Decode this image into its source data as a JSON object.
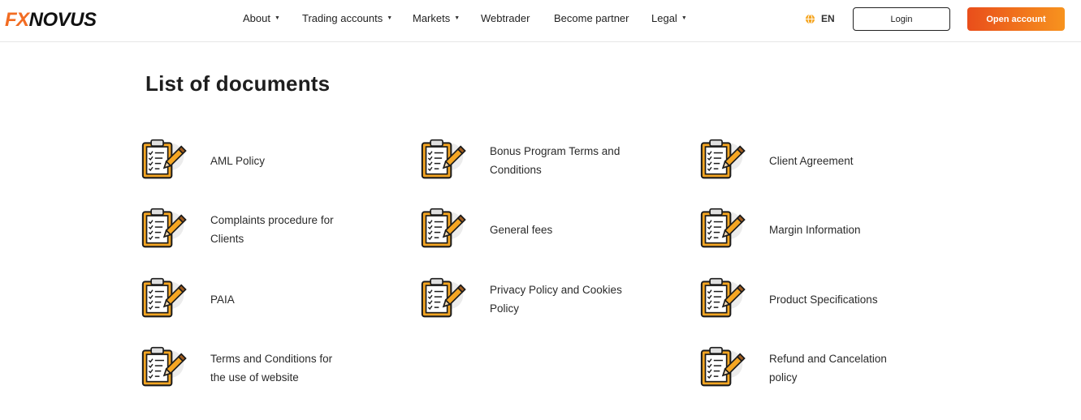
{
  "brand": {
    "logo_text": "FXNovus"
  },
  "nav": {
    "about": "About",
    "trading_accounts": "Trading accounts",
    "markets": "Markets",
    "webtrader": "Webtrader",
    "become_partner": "Become partner",
    "legal": "Legal",
    "caret": "▼"
  },
  "language": {
    "code": "EN"
  },
  "buttons": {
    "login": "Login",
    "open_account": "Open account"
  },
  "colors": {
    "accent": "#f26c22",
    "icon_brown": "#a15c1e",
    "icon_orange": "#f5a623"
  },
  "page": {
    "title": "List of documents"
  },
  "documents": [
    {
      "label": "AML Policy"
    },
    {
      "label": "Bonus Program Terms and Conditions"
    },
    {
      "label": "Client Agreement"
    },
    {
      "label": "Complaints procedure for Clients"
    },
    {
      "label": "General fees"
    },
    {
      "label": "Margin Information"
    },
    {
      "label": "PAIA"
    },
    {
      "label": "Privacy Policy and Cookies Policy"
    },
    {
      "label": "Product Specifications"
    },
    {
      "label": "Terms and Conditions for the use of website"
    },
    {
      "label": "Refund and Cancelation policy"
    }
  ]
}
